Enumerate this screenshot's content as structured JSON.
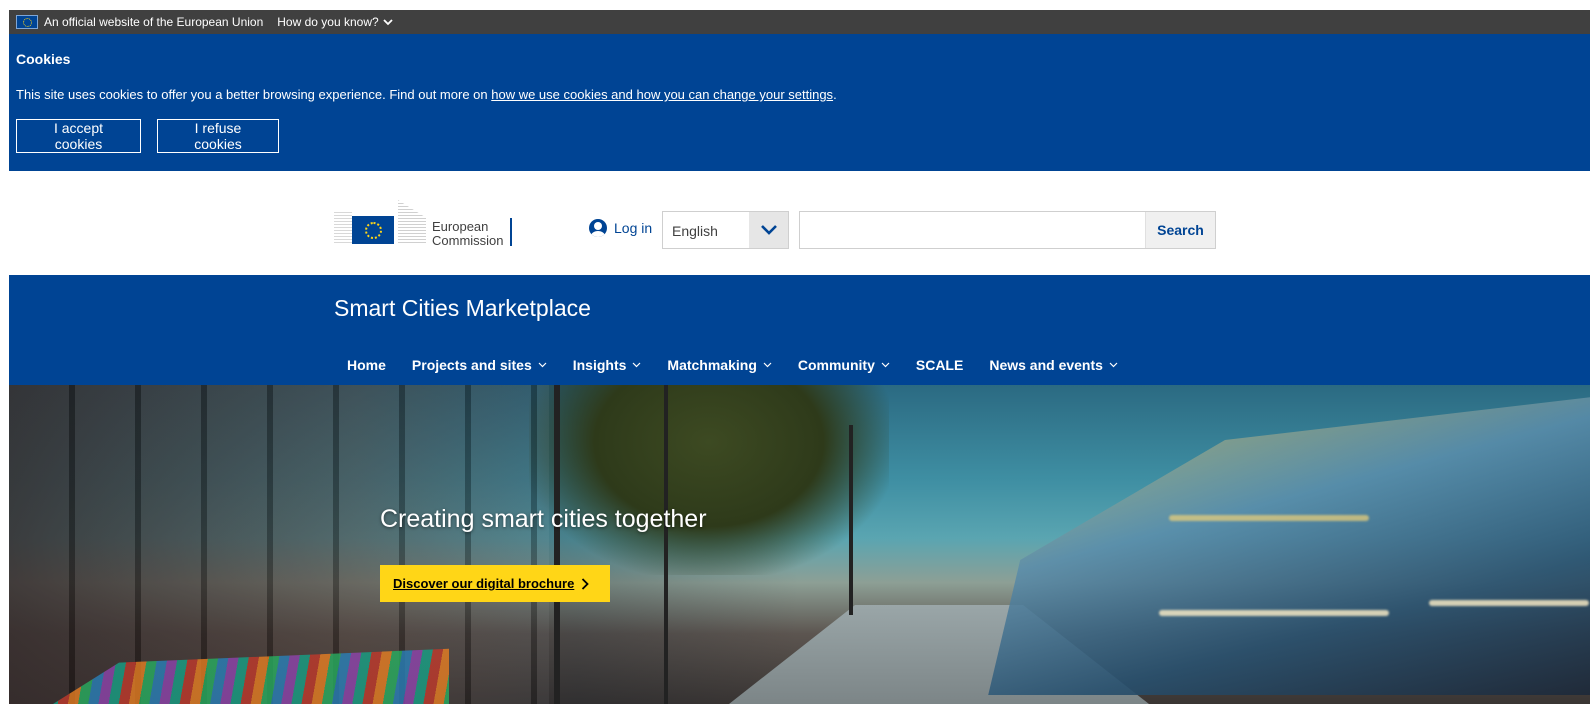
{
  "eu_bar": {
    "official_text": "An official website of the European Union",
    "how_label": "How do you know?"
  },
  "cookie": {
    "title": "Cookies",
    "text_before": "This site uses cookies to offer you a better browsing experience. Find out more on ",
    "link_text": "how we use cookies and how you can change your settings",
    "text_after": ".",
    "accept_label": "I accept cookies",
    "refuse_label": "I refuse cookies"
  },
  "header": {
    "logo_line1": "European",
    "logo_line2": "Commission",
    "login_label": "Log in",
    "language": "English",
    "search_value": "",
    "search_button": "Search"
  },
  "site": {
    "title": "Smart Cities Marketplace",
    "nav": [
      {
        "label": "Home"
      },
      {
        "label": "Projects and sites"
      },
      {
        "label": "Insights"
      },
      {
        "label": "Matchmaking"
      },
      {
        "label": "Community"
      },
      {
        "label": "SCALE"
      },
      {
        "label": "News and events"
      }
    ]
  },
  "hero": {
    "heading": "Creating smart cities together",
    "cta_label": "Discover our digital brochure"
  },
  "colors": {
    "eu_blue": "#004494",
    "eu_yellow": "#ffd617",
    "top_bar": "#404040"
  }
}
